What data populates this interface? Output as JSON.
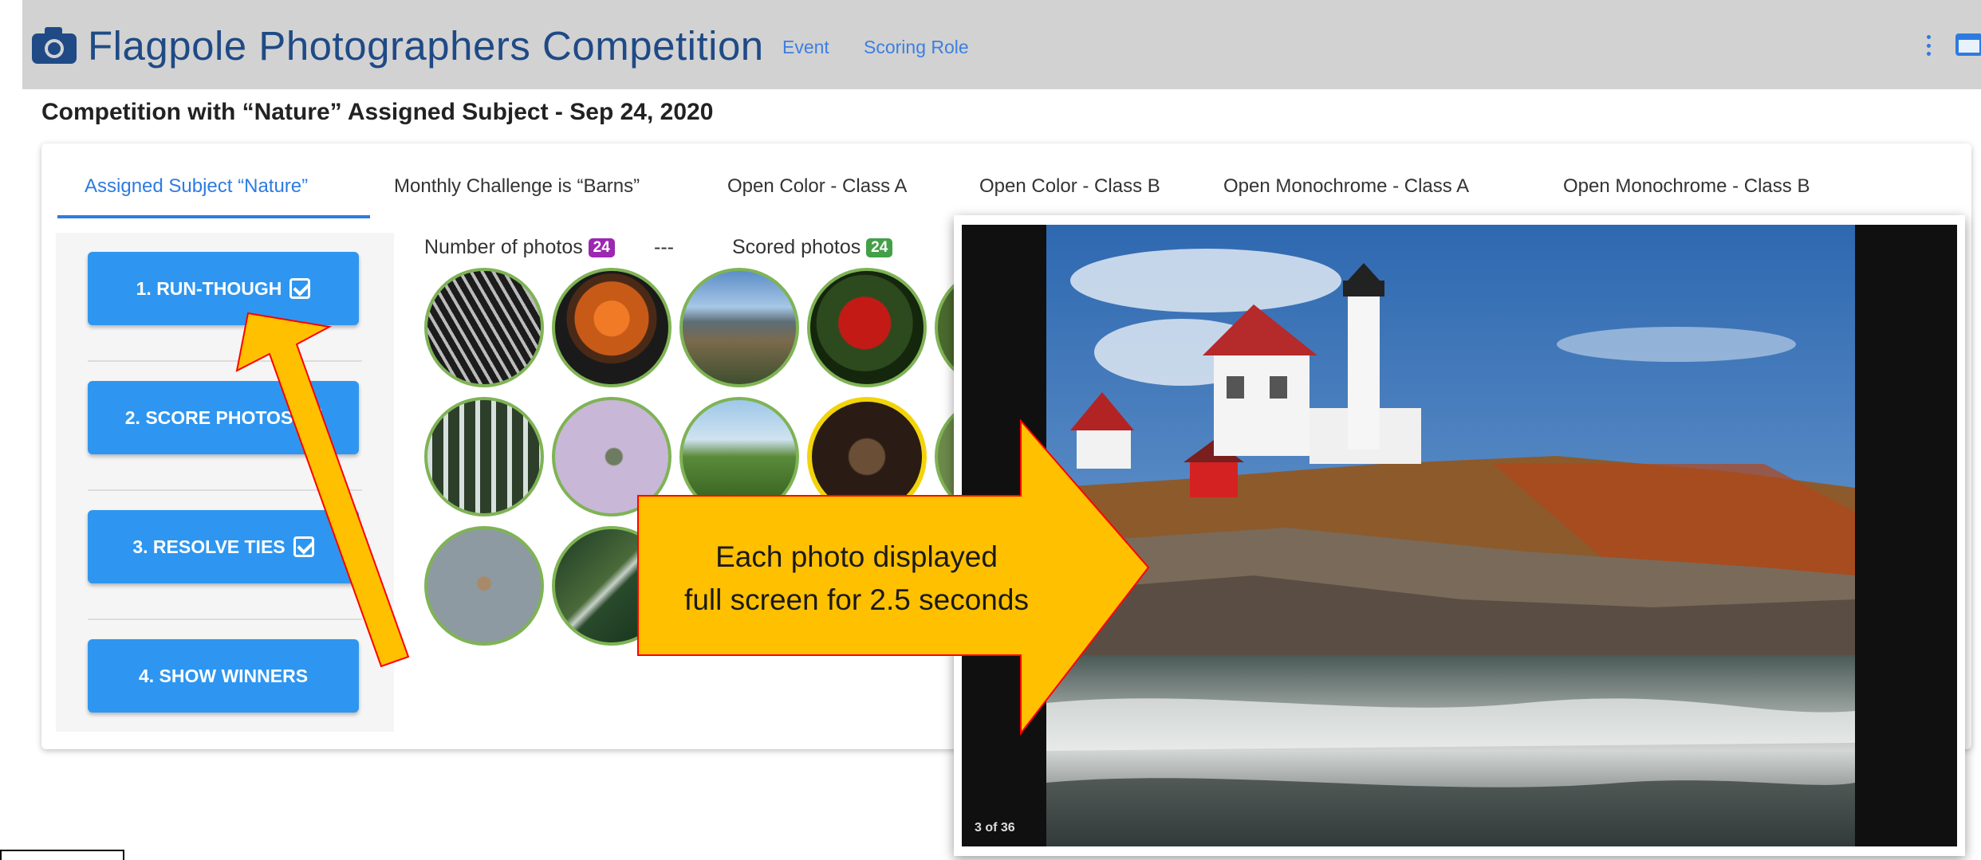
{
  "header": {
    "title": "Flagpole Photographers Competition",
    "nav_links": [
      "Event",
      "Scoring Role"
    ],
    "icons": {
      "camera": "camera-icon",
      "menu": "kebab-menu-icon",
      "window": "window-icon"
    }
  },
  "subtitle": "Competition with “Nature” Assigned Subject - Sep 24, 2020",
  "tabs": [
    {
      "label": "Assigned Subject “Nature”",
      "active": true
    },
    {
      "label": "Monthly Challenge is “Barns”",
      "active": false
    },
    {
      "label": "Open Color - Class A",
      "active": false
    },
    {
      "label": "Open Color - Class B",
      "active": false
    },
    {
      "label": "Open Monochrome - Class A",
      "active": false
    },
    {
      "label": "Open Monochrome - Class B",
      "active": false
    }
  ],
  "steps": [
    {
      "label": "1. RUN-THOUGH",
      "checked": true
    },
    {
      "label": "2. SCORE PHOTOS",
      "checked": true
    },
    {
      "label": "3. RESOLVE TIES",
      "checked": true
    },
    {
      "label": "4. SHOW WINNERS",
      "checked": false
    }
  ],
  "photos": {
    "count_label": "Number of photos",
    "count": "24",
    "separator": "---",
    "scored_label": "Scored photos",
    "scored": "24",
    "thumbnails": [
      "fern",
      "dahlia",
      "mountain-landscape",
      "cardinal",
      "waterfall",
      "hummingbird",
      "meadow",
      "owl-in-flight",
      "dragonfly",
      "damselfly"
    ]
  },
  "lightbox": {
    "counter": "3 of 36",
    "subject": "lighthouse-on-rocky-coast"
  },
  "annotation": {
    "line1": "Each photo displayed",
    "line2": "full screen for 2.5 seconds"
  },
  "colors": {
    "header_bg": "#d2d2d2",
    "title": "#1f4a86",
    "accent": "#2d7be0",
    "button": "#2e96f0",
    "badge_count": "#9c27b0",
    "badge_scored": "#43a047",
    "callout": "#ffc000",
    "callout_border": "#ff0000"
  }
}
